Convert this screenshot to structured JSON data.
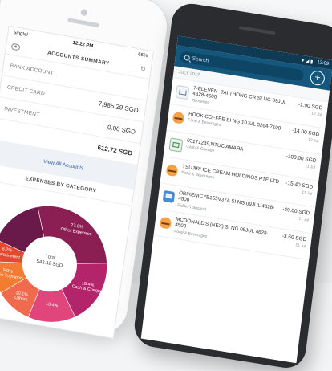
{
  "iphone": {
    "status": {
      "carrier": "Singtel",
      "time": "12:22 PM",
      "battery": "66%"
    },
    "title": "ACCOUNTS SUMMARY",
    "accounts": [
      {
        "label": "BANK ACCOUNT",
        "value": ""
      },
      {
        "label": "CREDIT CARD",
        "value": "7,985.29 SGD"
      },
      {
        "label": "INVESTMENT",
        "value": "0.00 SGD"
      }
    ],
    "total": "612.72 SGD",
    "view_all": "View All Accounts",
    "category_title": "EXPENSES BY CATEGORY",
    "donut": {
      "center_label": "Total",
      "center_value": "542.42 SGD",
      "segments": [
        {
          "label": "27.6%",
          "name": "Other Expenses",
          "percent": 27.6,
          "color": "#8b1e52"
        },
        {
          "label": "18.4%",
          "name": "Cash & Cheque",
          "percent": 18.4,
          "color": "#b4246a"
        },
        {
          "label": "13.4%",
          "name": "",
          "percent": 13.4,
          "color": "#e0457c"
        },
        {
          "label": "10.1%",
          "name": "Others",
          "percent": 10.1,
          "color": "#f06a4e"
        },
        {
          "label": "9.0%",
          "name": "Public Transport",
          "percent": 9.0,
          "color": "#f47b32"
        },
        {
          "label": "6.2%",
          "name": "Entertainment",
          "percent": 6.2,
          "color": "#e3492f"
        },
        {
          "label": "",
          "name": "",
          "percent": 15.3,
          "color": "#6a1a4a"
        }
      ]
    }
  },
  "android": {
    "status": {
      "time": "12:09"
    },
    "search_placeholder": "Search",
    "month": "JULY 2017",
    "transactions": [
      {
        "name": "7-ELEVEN -TAI THONG CR SI NG 09JUL 4628-4500",
        "category": "Groceries",
        "amount": "-1.90 SGD",
        "date": "12 Jul",
        "icon": "grocery"
      },
      {
        "name": "HOOK COFFEE SI NG 10JUL 5264-7100",
        "category": "Food & Beverages",
        "amount": "-14.00 SGD",
        "date": "12 Jul",
        "icon": "food"
      },
      {
        "name": "03171239,NTUC AMARA",
        "category": "Cash & Cheque",
        "amount": "-100.00 SGD",
        "date": "11 Jul",
        "icon": "cash"
      },
      {
        "name": "TSUJIRI ICE CREAM HOLDINGS PTE LTD",
        "category": "Food & Beverages",
        "amount": "-15.40 SGD",
        "date": "11 Jul",
        "icon": "food"
      },
      {
        "name": "OBIKENIC *B155V37A SI NG 09JUL 4628-4500",
        "category": "Public Transport",
        "amount": "-49.00 SGD",
        "date": "11 Jul",
        "icon": "transport"
      },
      {
        "name": "MCDONALD'S (NEX) SI NG 08JUL 4628-4500",
        "category": "Food & Beverages",
        "amount": "-3.60 SGD",
        "date": "11 Jul",
        "icon": "food"
      }
    ]
  }
}
